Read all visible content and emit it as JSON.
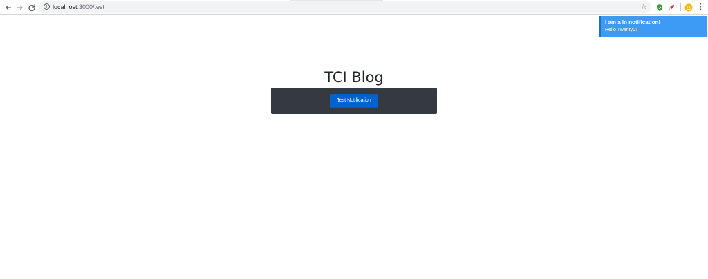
{
  "browser": {
    "url_host": "localhost",
    "url_rest": ":3000/test",
    "info_glyph": "i",
    "icons": [
      "back-icon",
      "forward-icon",
      "reload-icon",
      "info-icon",
      "star-icon",
      "shield-extension-icon",
      "rocket-extension-icon",
      "profile-avatar-icon",
      "menu-icon"
    ]
  },
  "notification": {
    "title": "I am a in notification!",
    "text": "Hello TwentyCI",
    "color": "#3e9bf5"
  },
  "page": {
    "title": "TCI Blog",
    "button_label": "Test Notification",
    "panel_color": "#343a40",
    "button_color": "#0062cc"
  }
}
